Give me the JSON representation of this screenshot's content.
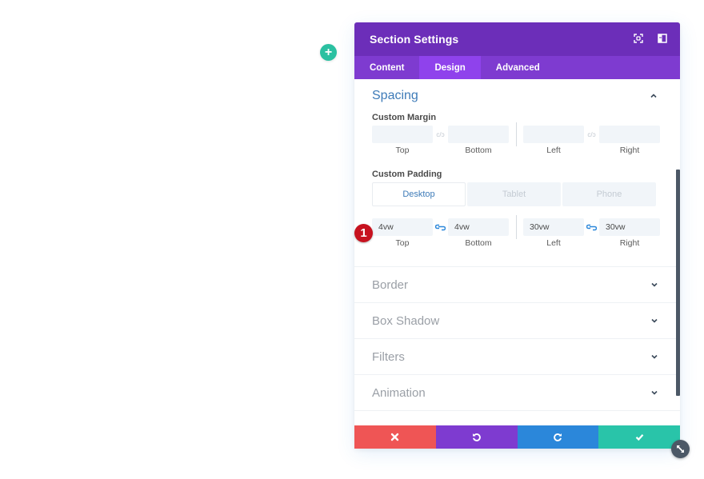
{
  "add_button": {
    "icon": "plus-icon",
    "label": "+"
  },
  "modal": {
    "title": "Section Settings",
    "header_icons": [
      "fullscreen-icon",
      "sidebar-icon"
    ],
    "tabs": [
      {
        "label": "Content",
        "active": false
      },
      {
        "label": "Design",
        "active": true
      },
      {
        "label": "Advanced",
        "active": false
      }
    ],
    "spacing": {
      "title": "Spacing",
      "expanded": true,
      "custom_margin": {
        "label": "Custom Margin",
        "values": {
          "top": "",
          "bottom": "",
          "left": "",
          "right": ""
        },
        "link_glyph": "c/ɔ",
        "sublabels": [
          "Top",
          "Bottom",
          "Left",
          "Right"
        ]
      },
      "custom_padding": {
        "label": "Custom Padding",
        "devices": [
          {
            "label": "Desktop",
            "active": true
          },
          {
            "label": "Tablet",
            "active": false
          },
          {
            "label": "Phone",
            "active": false
          }
        ],
        "values": {
          "top": "4vw",
          "bottom": "4vw",
          "left": "30vw",
          "right": "30vw"
        },
        "linked": true,
        "sublabels": [
          "Top",
          "Bottom",
          "Left",
          "Right"
        ]
      }
    },
    "step_badge": "1",
    "sections": [
      {
        "title": "Border"
      },
      {
        "title": "Box Shadow"
      },
      {
        "title": "Filters"
      },
      {
        "title": "Animation"
      }
    ],
    "footer": {
      "cancel_icon": "close-icon",
      "undo_icon": "undo-icon",
      "redo_icon": "redo-icon",
      "save_icon": "check-icon"
    },
    "colors": {
      "header": "#6c2eb9",
      "tabs": "#7e3bd0",
      "tab_active": "#8f42ec",
      "cancel": "#ef5555",
      "undo": "#7e3bd0",
      "redo": "#2b87da",
      "save": "#29c4a9",
      "link_active": "#2b87da",
      "badge": "#c7121f"
    }
  }
}
